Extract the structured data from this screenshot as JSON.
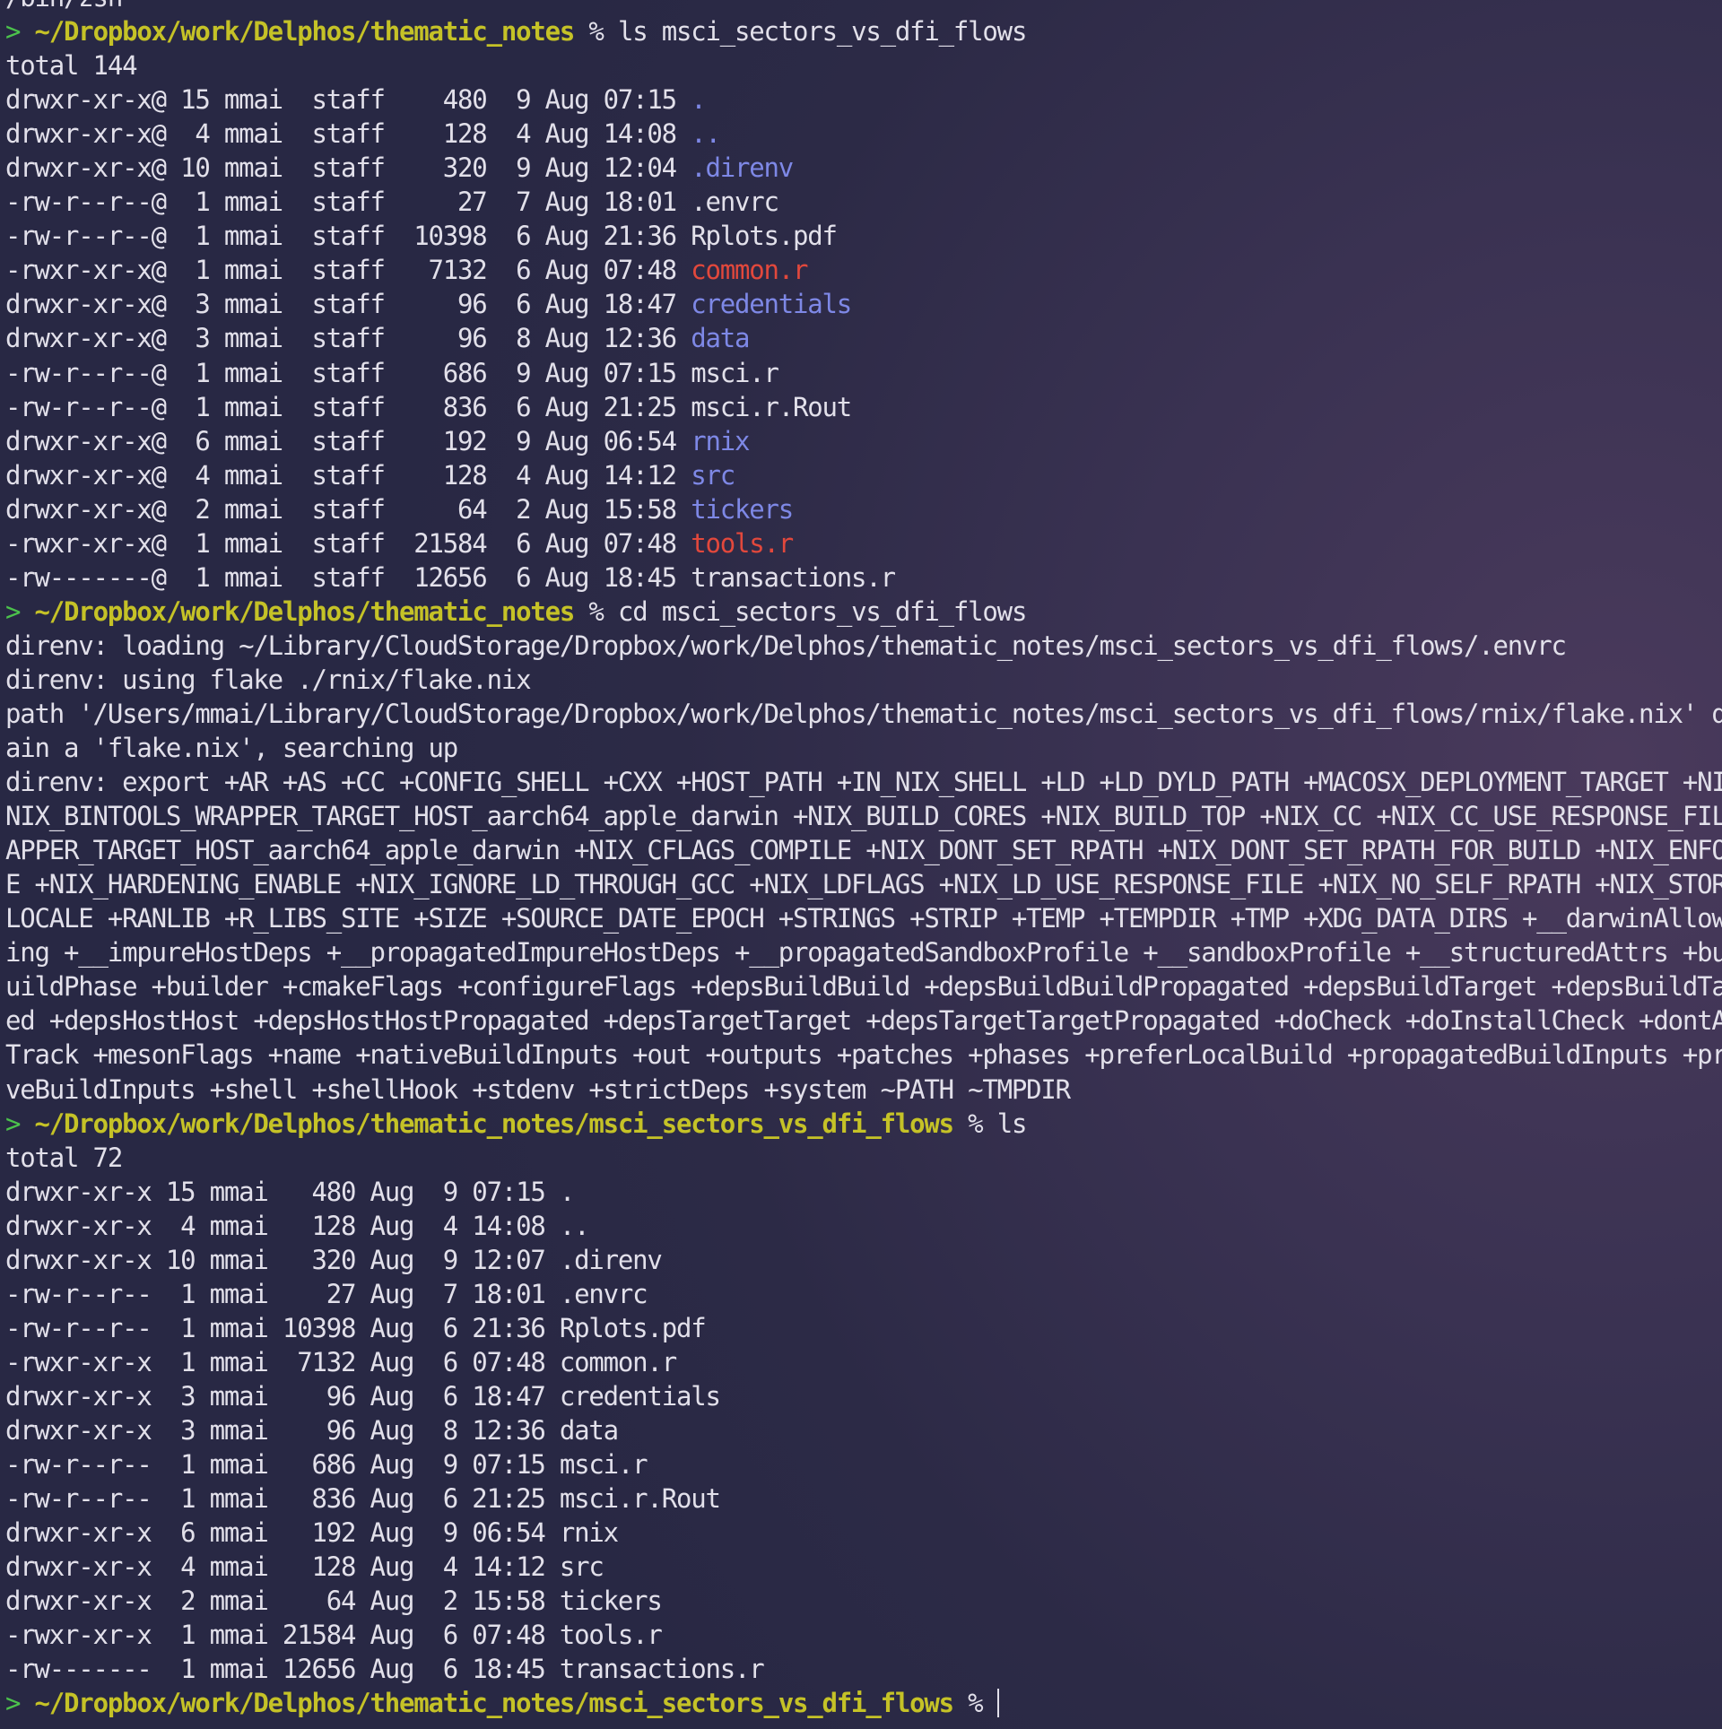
{
  "colors": {
    "prompt_arrow": "#4cc24c",
    "prompt_path": "#c5c227",
    "directory": "#7e88e6",
    "executable": "#e2483c",
    "text": "#e2e0ea"
  },
  "lines": [
    {
      "type": "text",
      "text": "/bin/zsh"
    },
    {
      "type": "prompt",
      "arrow": ">",
      "path": "~/Dropbox/work/Delphos/thematic_notes",
      "symbol": "%",
      "cmd": "ls msci_sectors_vs_dfi_flows"
    },
    {
      "type": "text",
      "text": "total 144"
    },
    {
      "type": "entry",
      "prefix": "drwxr-xr-x@ 15 mmai  staff    480  9 Aug 07:15",
      "name": ".",
      "kind": "dir"
    },
    {
      "type": "entry",
      "prefix": "drwxr-xr-x@  4 mmai  staff    128  4 Aug 14:08",
      "name": "..",
      "kind": "dir"
    },
    {
      "type": "entry",
      "prefix": "drwxr-xr-x@ 10 mmai  staff    320  9 Aug 12:04",
      "name": ".direnv",
      "kind": "dir"
    },
    {
      "type": "entry",
      "prefix": "-rw-r--r--@  1 mmai  staff     27  7 Aug 18:01",
      "name": ".envrc",
      "kind": "file"
    },
    {
      "type": "entry",
      "prefix": "-rw-r--r--@  1 mmai  staff  10398  6 Aug 21:36",
      "name": "Rplots.pdf",
      "kind": "file"
    },
    {
      "type": "entry",
      "prefix": "-rwxr-xr-x@  1 mmai  staff   7132  6 Aug 07:48",
      "name": "common.r",
      "kind": "exec"
    },
    {
      "type": "entry",
      "prefix": "drwxr-xr-x@  3 mmai  staff     96  6 Aug 18:47",
      "name": "credentials",
      "kind": "dir"
    },
    {
      "type": "entry",
      "prefix": "drwxr-xr-x@  3 mmai  staff     96  8 Aug 12:36",
      "name": "data",
      "kind": "dir"
    },
    {
      "type": "entry",
      "prefix": "-rw-r--r--@  1 mmai  staff    686  9 Aug 07:15",
      "name": "msci.r",
      "kind": "file"
    },
    {
      "type": "entry",
      "prefix": "-rw-r--r--@  1 mmai  staff    836  6 Aug 21:25",
      "name": "msci.r.Rout",
      "kind": "file"
    },
    {
      "type": "entry",
      "prefix": "drwxr-xr-x@  6 mmai  staff    192  9 Aug 06:54",
      "name": "rnix",
      "kind": "dir"
    },
    {
      "type": "entry",
      "prefix": "drwxr-xr-x@  4 mmai  staff    128  4 Aug 14:12",
      "name": "src",
      "kind": "dir"
    },
    {
      "type": "entry",
      "prefix": "drwxr-xr-x@  2 mmai  staff     64  2 Aug 15:58",
      "name": "tickers",
      "kind": "dir"
    },
    {
      "type": "entry",
      "prefix": "-rwxr-xr-x@  1 mmai  staff  21584  6 Aug 07:48",
      "name": "tools.r",
      "kind": "exec"
    },
    {
      "type": "entry",
      "prefix": "-rw-------@  1 mmai  staff  12656  6 Aug 18:45",
      "name": "transactions.r",
      "kind": "file"
    },
    {
      "type": "prompt",
      "arrow": ">",
      "path": "~/Dropbox/work/Delphos/thematic_notes",
      "symbol": "%",
      "cmd": "cd msci_sectors_vs_dfi_flows"
    },
    {
      "type": "text",
      "text": "direnv: loading ~/Library/CloudStorage/Dropbox/work/Delphos/thematic_notes/msci_sectors_vs_dfi_flows/.envrc"
    },
    {
      "type": "text",
      "text": "direnv: using flake ./rnix/flake.nix"
    },
    {
      "type": "text",
      "text": "path '/Users/mmai/Library/CloudStorage/Dropbox/work/Delphos/thematic_notes/msci_sectors_vs_dfi_flows/rnix/flake.nix' does not cor"
    },
    {
      "type": "text",
      "text": "ain a 'flake.nix', searching up"
    },
    {
      "type": "text",
      "text": "direnv: export +AR +AS +CC +CONFIG_SHELL +CXX +HOST_PATH +IN_NIX_SHELL +LD +LD_DYLD_PATH +MACOSX_DEPLOYMENT_TARGET +NIX_BINTOOLS"
    },
    {
      "type": "text",
      "text": "NIX_BINTOOLS_WRAPPER_TARGET_HOST_aarch64_apple_darwin +NIX_BUILD_CORES +NIX_BUILD_TOP +NIX_CC +NIX_CC_USE_RESPONSE_FILE +NIX_CC_W"
    },
    {
      "type": "text",
      "text": "APPER_TARGET_HOST_aarch64_apple_darwin +NIX_CFLAGS_COMPILE +NIX_DONT_SET_RPATH +NIX_DONT_SET_RPATH_FOR_BUILD +NIX_ENFORCE_NO_NATI"
    },
    {
      "type": "text",
      "text": "E +NIX_HARDENING_ENABLE +NIX_IGNORE_LD_THROUGH_GCC +NIX_LDFLAGS +NIX_LD_USE_RESPONSE_FILE +NIX_NO_SELF_RPATH +NIX_STORE +NM +PATH"
    },
    {
      "type": "text",
      "text": "LOCALE +RANLIB +R_LIBS_SITE +SIZE +SOURCE_DATE_EPOCH +STRINGS +STRIP +TEMP +TEMPDIR +TMP +XDG_DATA_DIRS +__darwinAllowLocalNetwor"
    },
    {
      "type": "text",
      "text": "ing +__impureHostDeps +__propagatedImpureHostDeps +__propagatedSandboxProfile +__sandboxProfile +__structuredAttrs +buildInputs +"
    },
    {
      "type": "text",
      "text": "uildPhase +builder +cmakeFlags +configureFlags +depsBuildBuild +depsBuildBuildPropagated +depsBuildTarget +depsBuildTargetPropaga"
    },
    {
      "type": "text",
      "text": "ed +depsHostHost +depsHostHostPropagated +depsTargetTarget +depsTargetTargetPropagated +doCheck +doInstallCheck +dontAddDisableDe"
    },
    {
      "type": "text",
      "text": "Track +mesonFlags +name +nativeBuildInputs +out +outputs +patches +phases +preferLocalBuild +propagatedBuildInputs +propagatedNat"
    },
    {
      "type": "text",
      "text": "veBuildInputs +shell +shellHook +stdenv +strictDeps +system ~PATH ~TMPDIR"
    },
    {
      "type": "prompt",
      "arrow": ">",
      "path": "~/Dropbox/work/Delphos/thematic_notes/msci_sectors_vs_dfi_flows",
      "symbol": "%",
      "cmd": "ls"
    },
    {
      "type": "text",
      "text": "total 72"
    },
    {
      "type": "entry",
      "prefix": "drwxr-xr-x 15 mmai   480 Aug  9 07:15",
      "name": ".",
      "kind": "file"
    },
    {
      "type": "entry",
      "prefix": "drwxr-xr-x  4 mmai   128 Aug  4 14:08",
      "name": "..",
      "kind": "file"
    },
    {
      "type": "entry",
      "prefix": "drwxr-xr-x 10 mmai   320 Aug  9 12:07",
      "name": ".direnv",
      "kind": "file"
    },
    {
      "type": "entry",
      "prefix": "-rw-r--r--  1 mmai    27 Aug  7 18:01",
      "name": ".envrc",
      "kind": "file"
    },
    {
      "type": "entry",
      "prefix": "-rw-r--r--  1 mmai 10398 Aug  6 21:36",
      "name": "Rplots.pdf",
      "kind": "file"
    },
    {
      "type": "entry",
      "prefix": "-rwxr-xr-x  1 mmai  7132 Aug  6 07:48",
      "name": "common.r",
      "kind": "file"
    },
    {
      "type": "entry",
      "prefix": "drwxr-xr-x  3 mmai    96 Aug  6 18:47",
      "name": "credentials",
      "kind": "file"
    },
    {
      "type": "entry",
      "prefix": "drwxr-xr-x  3 mmai    96 Aug  8 12:36",
      "name": "data",
      "kind": "file"
    },
    {
      "type": "entry",
      "prefix": "-rw-r--r--  1 mmai   686 Aug  9 07:15",
      "name": "msci.r",
      "kind": "file"
    },
    {
      "type": "entry",
      "prefix": "-rw-r--r--  1 mmai   836 Aug  6 21:25",
      "name": "msci.r.Rout",
      "kind": "file"
    },
    {
      "type": "entry",
      "prefix": "drwxr-xr-x  6 mmai   192 Aug  9 06:54",
      "name": "rnix",
      "kind": "file"
    },
    {
      "type": "entry",
      "prefix": "drwxr-xr-x  4 mmai   128 Aug  4 14:12",
      "name": "src",
      "kind": "file"
    },
    {
      "type": "entry",
      "prefix": "drwxr-xr-x  2 mmai    64 Aug  2 15:58",
      "name": "tickers",
      "kind": "file"
    },
    {
      "type": "entry",
      "prefix": "-rwxr-xr-x  1 mmai 21584 Aug  6 07:48",
      "name": "tools.r",
      "kind": "file"
    },
    {
      "type": "entry",
      "prefix": "-rw-------  1 mmai 12656 Aug  6 18:45",
      "name": "transactions.r",
      "kind": "file"
    },
    {
      "type": "prompt",
      "arrow": ">",
      "path": "~/Dropbox/work/Delphos/thematic_notes/msci_sectors_vs_dfi_flows",
      "symbol": "%",
      "cmd": "",
      "active": true
    }
  ]
}
